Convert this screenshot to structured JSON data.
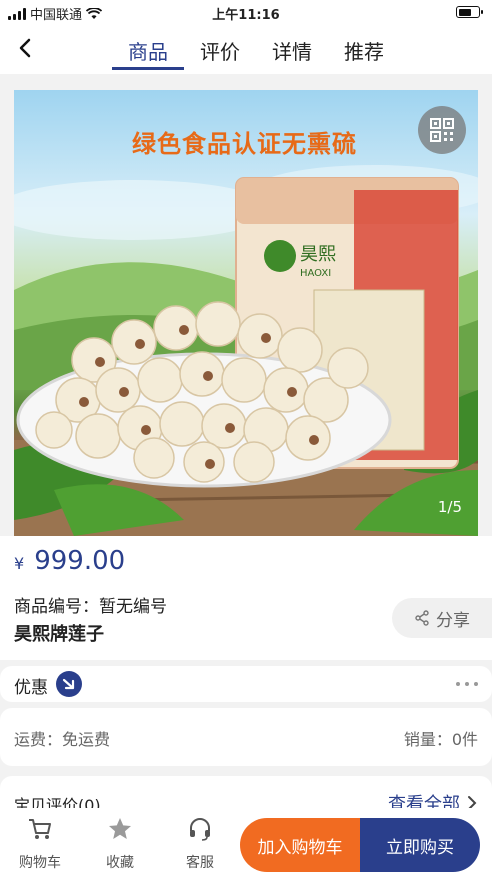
{
  "status_bar": {
    "carrier": "中国联通",
    "time": "上午11:16",
    "battery_level": 0.7
  },
  "nav": {
    "tabs": [
      {
        "label": "商品",
        "active": true
      },
      {
        "label": "评价",
        "active": false
      },
      {
        "label": "详情",
        "active": false
      },
      {
        "label": "推荐",
        "active": false
      }
    ]
  },
  "hero": {
    "headline": "绿色食品认证无熏硫",
    "page_indicator": "1/5",
    "brand_on_pack": "昊熙",
    "brand_sub": "HAOXI"
  },
  "product": {
    "currency": "¥",
    "price": "999.00",
    "code": "商品编号：暂无编号",
    "name": "昊熙牌莲子",
    "share_label": "分享"
  },
  "promo": {
    "label": "优惠"
  },
  "shipping": {
    "left": "运费：免运费",
    "right": "销量：0件"
  },
  "reviews": {
    "title": "宝贝评价(0)",
    "more_label": "查看全部"
  },
  "bottom_bar": {
    "cart_label": "购物车",
    "fav_label": "收藏",
    "service_label": "客服",
    "add_cart_label": "加入购物车",
    "buy_now_label": "立即购买"
  },
  "colors": {
    "accent": "#2a3f8c",
    "orange": "#f16b21",
    "headline": "#e76a18"
  },
  "icons": {
    "back": "chevron-left-icon",
    "qr": "qr-code-icon",
    "share": "share-icon",
    "promo": "arrow-badge-icon",
    "more": "chevron-right-icon",
    "cart": "cart-icon",
    "fav": "star-icon",
    "service": "headset-icon"
  }
}
